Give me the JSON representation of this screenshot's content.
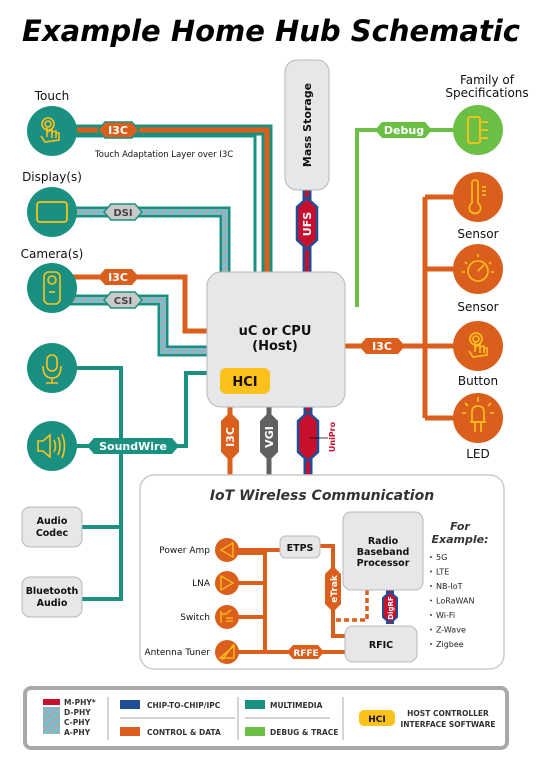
{
  "title": "Example Home Hub Schematic",
  "host": {
    "line1": "uC or CPU",
    "line2": "(Host)",
    "hci_badge": "HCI"
  },
  "mass_storage": {
    "label": "Mass Storage",
    "link": "UFS"
  },
  "left_devices": {
    "touch": {
      "label": "Touch",
      "link": "I3C",
      "note": "Touch Adaptation Layer over I3C"
    },
    "display": {
      "label": "Display(s)",
      "link": "DSI"
    },
    "camera": {
      "label": "Camera(s)",
      "link_control": "I3C",
      "link_data": "CSI"
    },
    "audio": {
      "link": "SoundWire",
      "codec": [
        "Audio",
        "Codec"
      ],
      "bluetooth": [
        "Bluetooth",
        "Audio"
      ]
    }
  },
  "right_devices": {
    "debug": {
      "label_line1": "Family of",
      "label_line2": "Specifications",
      "link": "Debug"
    },
    "bus_link": "I3C",
    "sensor1": "Sensor",
    "sensor2": "Sensor",
    "button": "Button",
    "led": "LED"
  },
  "host_bottom_links": {
    "i3c": "I3C",
    "vgi": "VGI",
    "unipro": "UniPro"
  },
  "iot": {
    "title": "IoT Wireless Communication",
    "components": [
      "Power Amp",
      "LNA",
      "Switch",
      "Antenna Tuner"
    ],
    "etps": "ETPS",
    "baseband": [
      "Radio",
      "Baseband",
      "Processor"
    ],
    "rfic": "RFIC",
    "etrak": "eTrak",
    "digrf": "DigRF",
    "rffe": "RFFE",
    "examples_title": [
      "For",
      "Example:"
    ],
    "examples": [
      "5G",
      "LTE",
      "NB-IoT",
      "LoRaWAN",
      "Wi-Fi",
      "Z-Wave",
      "Zigbee"
    ]
  },
  "legend": {
    "phy": [
      "M-PHY*",
      "D-PHY",
      "C-PHY",
      "A-PHY"
    ],
    "chip_to_chip": "CHIP-TO-CHIP/IPC",
    "control_data": "CONTROL & DATA",
    "multimedia": "MULTIMEDIA",
    "debug_trace": "DEBUG & TRACE",
    "hci": "HCI",
    "hci_desc": [
      "HOST CONTROLLER",
      "INTERFACE SOFTWARE"
    ]
  },
  "colors": {
    "teal": "#1a9080",
    "orange": "#db5f1c",
    "green": "#6cbf45",
    "red": "#c8102e",
    "blue": "#1f4e96",
    "gray": "#5f6062",
    "yellow": "#fcc21b",
    "box": "#e6e7e8"
  }
}
